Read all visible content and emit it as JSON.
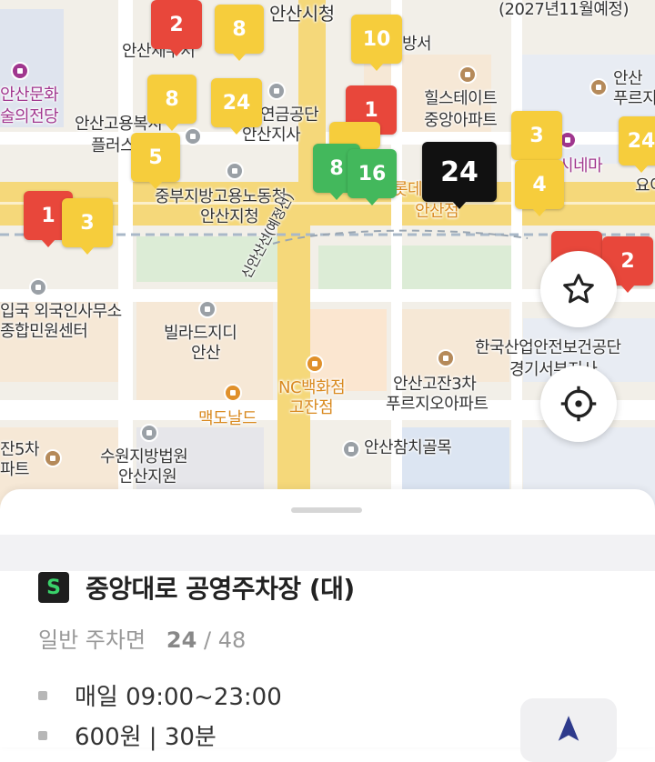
{
  "map": {
    "labels": {
      "ansan_city_hall": "안산시청",
      "planned_2027": "(2027년11월예정)",
      "ansan_tax_office": "안산세무서",
      "police_station": "방서",
      "ansan_culture_l1": "안산문화",
      "ansan_culture_l2": "술의전당",
      "ansan_employ_l1": "안산고용복지",
      "ansan_employ_l2": "플러스",
      "pension_l1": "연금공단",
      "pension_l2": "안산지사",
      "hillstate_l1": "힐스테이트",
      "hillstate_l2": "중앙아파트",
      "ansan_prugio_l1": "안산",
      "ansan_prugio_l2": "푸르지",
      "cinema": "시네마",
      "yoe": "요이",
      "labor_office_l1": "중부지방고용노동청",
      "labor_office_l2": "안산지청",
      "lotte_l1": "롯데",
      "lotte_l2": "안산점",
      "planned_line": "신안산선(예정선)",
      "immigration_l1": "입국 외국인사무소",
      "immigration_l2": "종합민원센터",
      "villa_l1": "빌라드지디",
      "villa_l2": "안산",
      "mcdonalds": "맥도날드",
      "nc_l1": "NC백화점",
      "nc_l2": "고잔점",
      "kosha_l1": "한국산업안전보건공단",
      "kosha_l2": "경기서부지사",
      "gojan_l1": "안산고잔3차",
      "gojan_l2": "푸르지오아파트",
      "chamchi": "안산참치골목",
      "gojan5_l1": "잔5차",
      "gojan5_l2": "파트",
      "court_l1": "수원지방법원",
      "court_l2": "안산지원"
    },
    "markers": [
      {
        "label": "2",
        "color": "red"
      },
      {
        "label": "8",
        "color": "yellow"
      },
      {
        "label": "10",
        "color": "yellow"
      },
      {
        "label": "8",
        "color": "yellow"
      },
      {
        "label": "24",
        "color": "yellow"
      },
      {
        "label": "1",
        "color": "red"
      },
      {
        "label": "5",
        "color": "yellow"
      },
      {
        "label": "8",
        "color": "green"
      },
      {
        "label": "16",
        "color": "green"
      },
      {
        "label": "24",
        "color": "black"
      },
      {
        "label": "3",
        "color": "yellow"
      },
      {
        "label": "4",
        "color": "yellow"
      },
      {
        "label": "24",
        "color": "yellow"
      },
      {
        "label": "1",
        "color": "red"
      },
      {
        "label": "3",
        "color": "yellow"
      },
      {
        "label": "2",
        "color": "red"
      }
    ],
    "icons": {
      "favorite": "star-icon",
      "locate": "crosshair-icon"
    }
  },
  "sheet": {
    "badge": "S",
    "title": "중앙대로 공영주차장 (대)",
    "avail_label": "일반 주차면",
    "avail_count": "24",
    "avail_sep": "/",
    "avail_total": "48",
    "hours": "매일 09:00~23:00",
    "fee": "600원 | 30분",
    "nav_icon": "navigation-arrow-icon"
  },
  "colors": {
    "red": "#e8473b",
    "yellow": "#f6cd3c",
    "green": "#43b85c",
    "black": "#111111",
    "badge_green": "#39d26a"
  }
}
